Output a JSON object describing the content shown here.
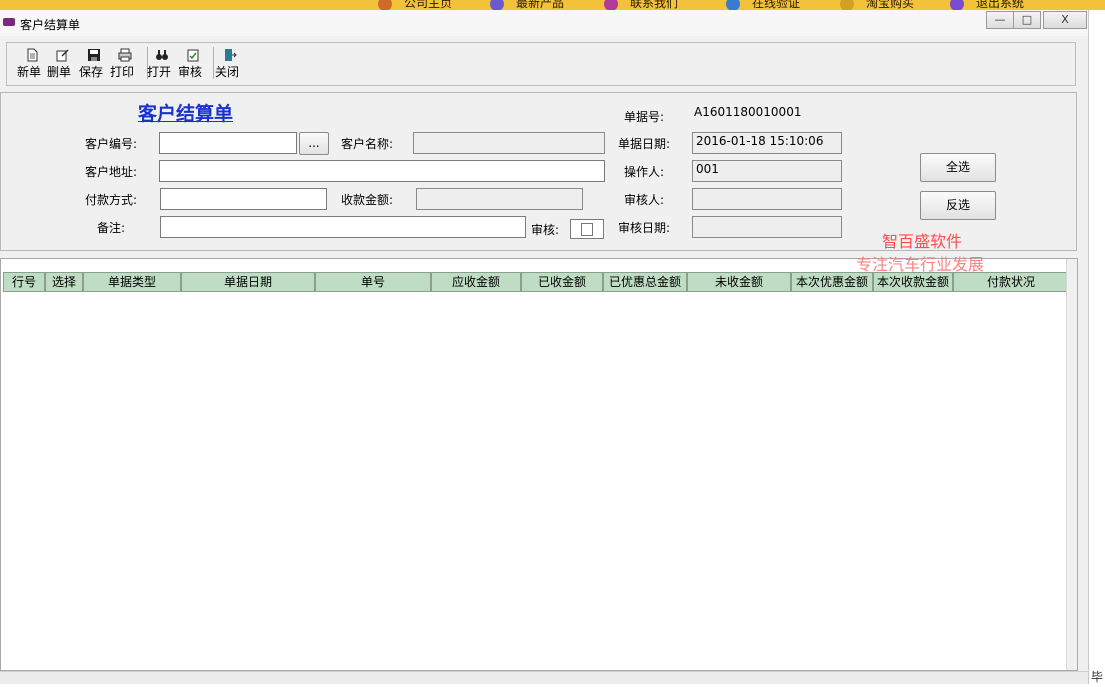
{
  "parent_app": {
    "top_menu": [
      "公司主页",
      "最新产品",
      "联系我们",
      "在线验证",
      "淘宝购买",
      "退出系统"
    ]
  },
  "window": {
    "title": "客户结算单",
    "controls": {
      "minimize": "—",
      "maximize": "□",
      "close": "X"
    }
  },
  "toolbar": {
    "buttons": [
      {
        "label": "新单",
        "icon": "new-document-icon"
      },
      {
        "label": "删单",
        "icon": "edit-document-icon"
      },
      {
        "label": "保存",
        "icon": "save-disk-icon"
      },
      {
        "label": "打印",
        "icon": "printer-icon"
      },
      {
        "label": "打开",
        "icon": "binoculars-icon"
      },
      {
        "label": "审核",
        "icon": "clipboard-check-icon"
      },
      {
        "label": "关闭",
        "icon": "exit-door-icon"
      }
    ]
  },
  "form": {
    "title": "客户结算单",
    "customer_code_label": "客户编号:",
    "customer_code_value": "",
    "browse_button": "...",
    "customer_name_label": "客户名称:",
    "customer_name_value": "",
    "customer_address_label": "客户地址:",
    "customer_address_value": "",
    "payment_method_label": "付款方式:",
    "payment_method_value": "",
    "receive_amount_label": "收款金额:",
    "receive_amount_value": "",
    "remark_label": "备注:",
    "remark_value": "",
    "audit_label": "审核:",
    "doc_no_label": "单据号:",
    "doc_no_value": "A1601180010001",
    "doc_date_label": "单据日期:",
    "doc_date_value": "2016-01-18 15:10:06",
    "operator_label": "操作人:",
    "operator_value": "001",
    "auditor_label": "审核人:",
    "auditor_value": "",
    "audit_date_label": "审核日期:",
    "audit_date_value": "",
    "select_all_button": "全选",
    "invert_button": "反选"
  },
  "watermark": {
    "line1": "智百盛软件",
    "line2": "专注汽车行业发展"
  },
  "grid": {
    "columns": [
      "行号",
      "选择",
      "单据类型",
      "单据日期",
      "单号",
      "应收金额",
      "已收金额",
      "已优惠总金额",
      "未收金额",
      "本次优惠金额",
      "本次收款金额",
      "付款状况"
    ],
    "rows": []
  },
  "corner_text": "毕"
}
